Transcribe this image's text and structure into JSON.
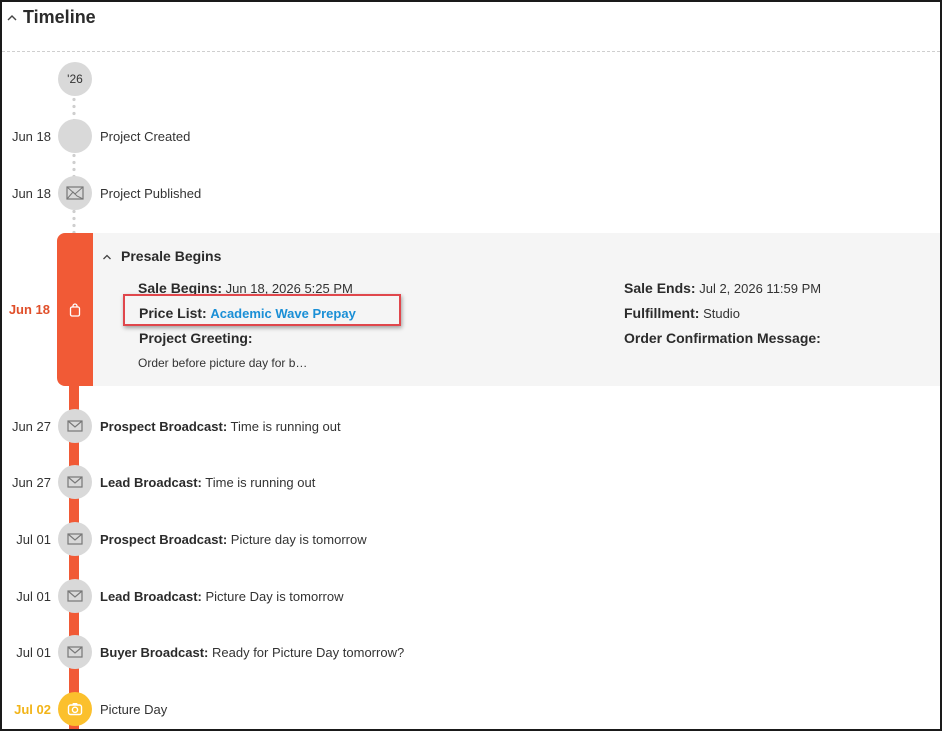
{
  "header": {
    "title": "Timeline"
  },
  "year_marker": "'26",
  "events": [
    {
      "date": "Jun 18",
      "label": "Project Created",
      "icon": "blank-circle-icon"
    },
    {
      "date": "Jun 18",
      "label": "Project Published",
      "icon": "image-icon"
    }
  ],
  "presale": {
    "date": "Jun 18",
    "title": "Presale Begins",
    "icon": "shopping-bag-icon",
    "sale_begins_key": "Sale Begins:",
    "sale_begins_value": "Jun 18, 2026 5:25 PM",
    "price_list_key": "Price List:",
    "price_list_value": "Academic Wave Prepay",
    "project_greeting_key": "Project Greeting:",
    "project_greeting_value": "Order before picture day for b…",
    "sale_ends_key": "Sale Ends:",
    "sale_ends_value": "Jul 2, 2026 11:59 PM",
    "fulfillment_key": "Fulfillment:",
    "fulfillment_value": "Studio",
    "order_confirmation_key": "Order Confirmation Message:"
  },
  "broadcasts": [
    {
      "date": "Jun 27",
      "type": "Prospect Broadcast:",
      "text": "Time is running out",
      "icon": "envelope-icon"
    },
    {
      "date": "Jun 27",
      "type": "Lead Broadcast:",
      "text": "Time is running out",
      "icon": "envelope-icon"
    },
    {
      "date": "Jul 01",
      "type": "Prospect Broadcast:",
      "text": "Picture day is tomorrow",
      "icon": "envelope-icon"
    },
    {
      "date": "Jul 01",
      "type": "Lead Broadcast:",
      "text": "Picture Day is tomorrow",
      "icon": "envelope-icon"
    },
    {
      "date": "Jul 01",
      "type": "Buyer Broadcast:",
      "text": "Ready for Picture Day tomorrow?",
      "icon": "envelope-icon"
    }
  ],
  "picture_day": {
    "date": "Jul 02",
    "label": "Picture Day",
    "icon": "camera-icon"
  },
  "colors": {
    "accent_red": "#f15a36",
    "picture_day_yellow": "#fbc02d",
    "link_blue": "#1a8fd6",
    "highlight_box": "#e0474c"
  }
}
